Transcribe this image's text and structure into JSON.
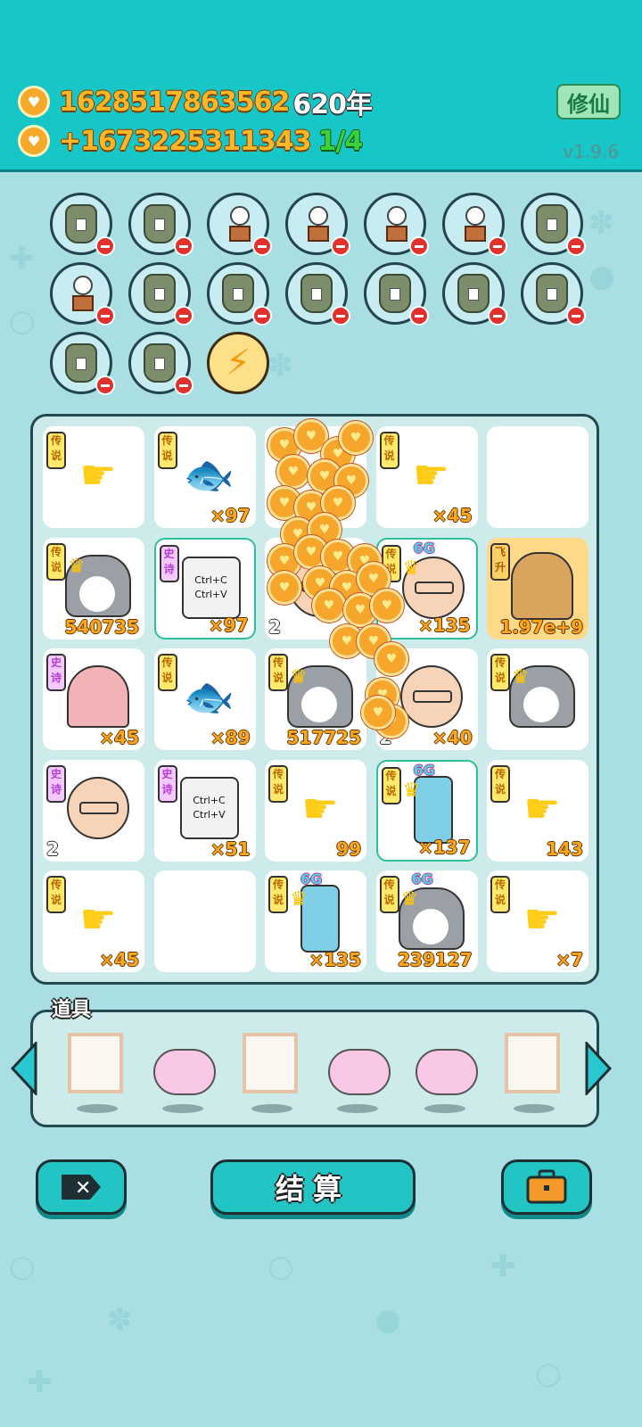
{
  "header": {
    "coins_total": "1628517863562",
    "years": "620年",
    "coins_rate": "+1673225311343",
    "progress": "1/4",
    "xiuxian_label": "修仙",
    "version": "v1.9.6"
  },
  "collected": {
    "row1": [
      "bag",
      "bag",
      "flower",
      "flower",
      "flower",
      "flower",
      "bag"
    ],
    "row2": [
      "flower",
      "bag",
      "bag",
      "bag",
      "bag",
      "bag",
      "bag"
    ],
    "row3": [
      "bag",
      "bag",
      "bolt"
    ]
  },
  "grid": {
    "cells": [
      {
        "tag": "传说",
        "icon": "hand-icon",
        "qty": "",
        "lvl": ""
      },
      {
        "tag": "传说",
        "icon": "fish-icon",
        "qty": "×97",
        "lvl": ""
      },
      {
        "tag": "",
        "icon": "coin-swarm",
        "qty": "",
        "lvl": ""
      },
      {
        "tag": "传说",
        "icon": "hand-icon",
        "qty": "×45",
        "lvl": ""
      },
      {
        "tag": "",
        "icon": "empty",
        "qty": "",
        "lvl": ""
      },
      {
        "tag": "传说",
        "icon": "husky-icon",
        "qty": "540735",
        "lvl": ""
      },
      {
        "tag": "史诗",
        "icon": "copy-paste-icon",
        "qty": "×97",
        "lvl": ""
      },
      {
        "tag": "",
        "icon": "oldman-icon",
        "qty": "",
        "lvl": "2"
      },
      {
        "tag": "传说",
        "icon": "oldman-glasses-icon",
        "qty": "×135",
        "lvl": "",
        "badge": "6G"
      },
      {
        "tag": "飞升",
        "icon": "cup-icon",
        "qty": "1.97e+9",
        "lvl": ""
      },
      {
        "tag": "史诗",
        "icon": "cathouse-icon",
        "qty": "×45",
        "lvl": ""
      },
      {
        "tag": "传说",
        "icon": "fish-icon",
        "qty": "×89",
        "lvl": ""
      },
      {
        "tag": "传说",
        "icon": "husky-icon",
        "qty": "517725",
        "lvl": ""
      },
      {
        "tag": "",
        "icon": "oldman-icon",
        "qty": "×40",
        "lvl": "2"
      },
      {
        "tag": "传说",
        "icon": "husky-icon",
        "qty": "",
        "lvl": ""
      },
      {
        "tag": "史诗",
        "icon": "oldman-icon",
        "qty": "",
        "lvl": "2"
      },
      {
        "tag": "史诗",
        "icon": "copy-paste-icon",
        "qty": "×51",
        "lvl": ""
      },
      {
        "tag": "传说",
        "icon": "hand-icon",
        "qty": "99",
        "lvl": ""
      },
      {
        "tag": "传说",
        "icon": "fridge-icon",
        "qty": "×137",
        "lvl": "",
        "badge": "6G"
      },
      {
        "tag": "传说",
        "icon": "hand-icon",
        "qty": "143",
        "lvl": ""
      },
      {
        "tag": "传说",
        "icon": "hand-icon",
        "qty": "×45",
        "lvl": ""
      },
      {
        "tag": "",
        "icon": "empty",
        "qty": "",
        "lvl": ""
      },
      {
        "tag": "传说",
        "icon": "fridge-icon",
        "qty": "×135",
        "lvl": "",
        "badge": "6G"
      },
      {
        "tag": "传说",
        "icon": "husky-icon",
        "qty": "239127",
        "lvl": "",
        "badge": "6G"
      },
      {
        "tag": "传说",
        "icon": "hand-icon",
        "qty": "×7",
        "lvl": ""
      }
    ],
    "copy_paste_text": [
      "Ctrl+C",
      "Ctrl+V"
    ]
  },
  "props": {
    "title": "道具",
    "items": [
      "frame",
      "pig",
      "frame",
      "pig",
      "pig",
      "frame"
    ]
  },
  "buttons": {
    "settle_label": "结算"
  },
  "colors": {
    "header_bg": "#17c6c7",
    "page_bg": "#a9dfe3",
    "accent": "#22c4c4",
    "coin": "#f6a62a"
  }
}
